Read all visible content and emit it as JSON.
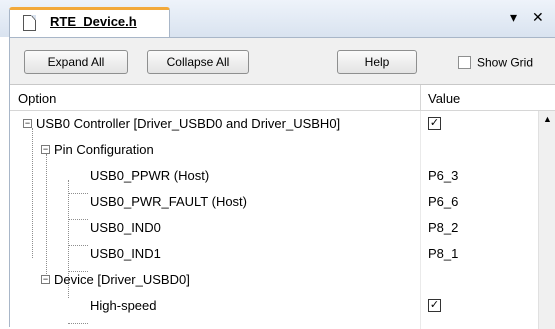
{
  "tab": {
    "title": "RTE_Device.h"
  },
  "window_controls": {
    "menu_glyph": "▾",
    "close_glyph": "✕"
  },
  "toolbar": {
    "expand_all": "Expand All",
    "collapse_all": "Collapse All",
    "help": "Help",
    "show_grid": "Show Grid",
    "show_grid_checked": false
  },
  "grid": {
    "columns": [
      "Option",
      "Value"
    ],
    "rows": [
      {
        "label": "USB0 Controller [Driver_USBD0 and Driver_USBH0]",
        "value": "",
        "checkbox": true,
        "checked": true,
        "level": 0,
        "expander": "minus"
      },
      {
        "label": "Pin Configuration",
        "value": "",
        "checkbox": false,
        "level": 1,
        "expander": "minus"
      },
      {
        "label": "USB0_PPWR (Host)",
        "value": "P6_3",
        "checkbox": false,
        "level": 2
      },
      {
        "label": "USB0_PWR_FAULT (Host)",
        "value": "P6_6",
        "checkbox": false,
        "level": 2
      },
      {
        "label": "USB0_IND0",
        "value": "P8_2",
        "checkbox": false,
        "level": 2
      },
      {
        "label": "USB0_IND1",
        "value": "P8_1",
        "checkbox": false,
        "level": 2
      },
      {
        "label": "Device [Driver_USBD0]",
        "value": "",
        "checkbox": false,
        "level": 1,
        "expander": "minus"
      },
      {
        "label": "High-speed",
        "value": "",
        "checkbox": true,
        "checked": true,
        "level": 2
      }
    ]
  },
  "glyphs": {
    "check": "✓",
    "minus": "−",
    "scroll_up": "▲"
  },
  "icons": {
    "tab_icon": "document-icon"
  }
}
